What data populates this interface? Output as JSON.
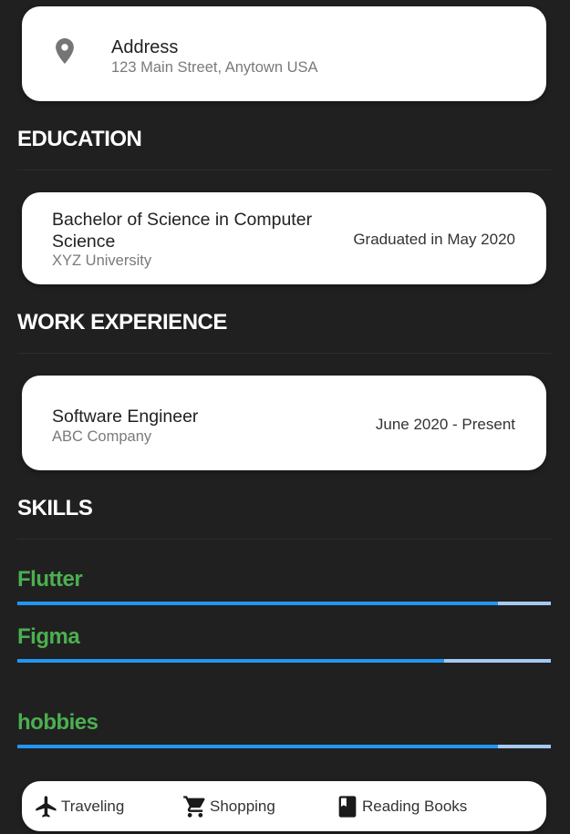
{
  "address": {
    "icon": "location-pin-icon",
    "label": "Address",
    "value": "123 Main Street, Anytown USA"
  },
  "education": {
    "heading": "EDUCATION",
    "degree": "Bachelor of Science in Computer Science",
    "school": "XYZ University",
    "date": "Graduated in May 2020"
  },
  "work": {
    "heading": "WORK EXPERIENCE",
    "title": "Software Engineer",
    "company": "ABC Company",
    "date": "June 2020 - Present"
  },
  "skills": {
    "heading": "SKILLS",
    "items": [
      {
        "name": "Flutter",
        "level": 0.9
      },
      {
        "name": "Figma",
        "level": 0.8
      },
      {
        "name": "hobbies",
        "level": 0.9
      }
    ]
  },
  "hobbies": {
    "items": [
      {
        "label": "Traveling",
        "icon": "airplane-icon"
      },
      {
        "label": "Shopping",
        "icon": "shopping-cart-icon"
      },
      {
        "label": "Reading Books",
        "icon": "book-icon"
      }
    ]
  },
  "colors": {
    "background": "#202020",
    "card": "#ffffff",
    "skill_name": "#4caf50",
    "bar_fill": "#2196f3",
    "bar_track": "#a3c9f0"
  }
}
